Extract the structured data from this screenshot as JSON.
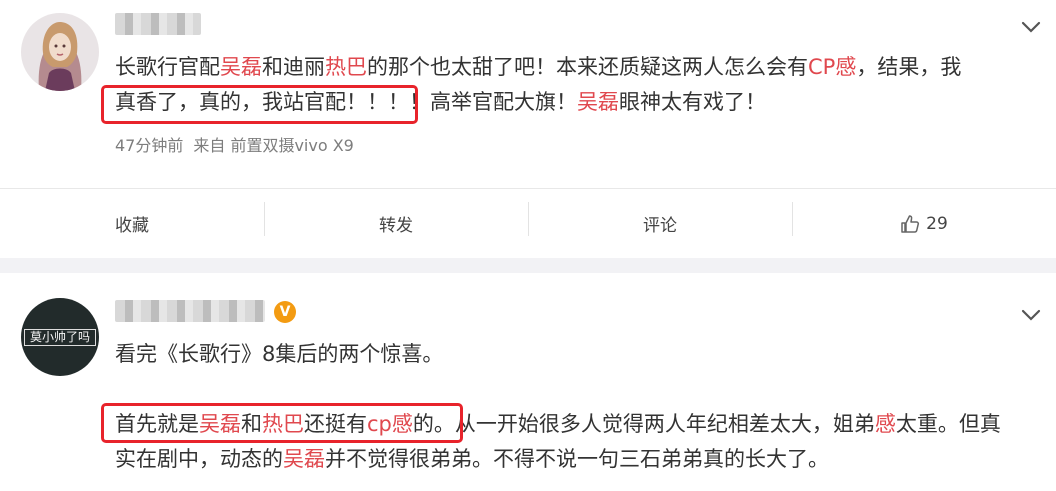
{
  "posts": [
    {
      "lines": [
        [
          {
            "t": "长歌行官配"
          },
          {
            "t": "吴磊",
            "hl": true
          },
          {
            "t": "和迪丽"
          },
          {
            "t": "热巴",
            "hl": true
          },
          {
            "t": "的那个也太甜了吧！本来还质疑这两人怎么会有"
          },
          {
            "t": "CP感",
            "hl": true
          },
          {
            "t": "，结果，我"
          }
        ],
        [
          {
            "t": "真香了，真的，我站官配！！！！高举官配大旗！"
          },
          {
            "t": "吴磊",
            "hl": true
          },
          {
            "t": "眼神太有戏了！"
          }
        ]
      ],
      "meta": {
        "time": "47分钟前",
        "source": "来自 前置双摄vivo X9"
      },
      "actions": {
        "favorite": "收藏",
        "repost": "转发",
        "comment": "评论",
        "like_count": "29"
      }
    },
    {
      "lines": [
        [
          {
            "t": "看完《长歌行》8集后的两个惊喜。"
          }
        ],
        [],
        [
          {
            "t": "首先就是"
          },
          {
            "t": "吴磊",
            "hl": true
          },
          {
            "t": "和"
          },
          {
            "t": "热巴",
            "hl": true
          },
          {
            "t": "还挺有"
          },
          {
            "t": "cp感",
            "hl": true
          },
          {
            "t": "的。从一开始很多人觉得两人年纪相差太大，姐弟"
          },
          {
            "t": "感",
            "hl": true
          },
          {
            "t": "太重。但真"
          }
        ],
        [
          {
            "t": "实在剧中，动态的"
          },
          {
            "t": "吴磊",
            "hl": true
          },
          {
            "t": "并不觉得很弟弟。不得不说一句三石弟弟真的长大了。"
          }
        ]
      ],
      "avatar_text": "莫小帅了吗"
    }
  ],
  "colors": {
    "highlight": "#e0484e",
    "box": "#e8232b",
    "vip_badge": "#f39b12"
  },
  "icons": {
    "collapse": "chevron-down-icon",
    "like": "thumbs-up-icon",
    "verified": "verified-badge-icon"
  }
}
